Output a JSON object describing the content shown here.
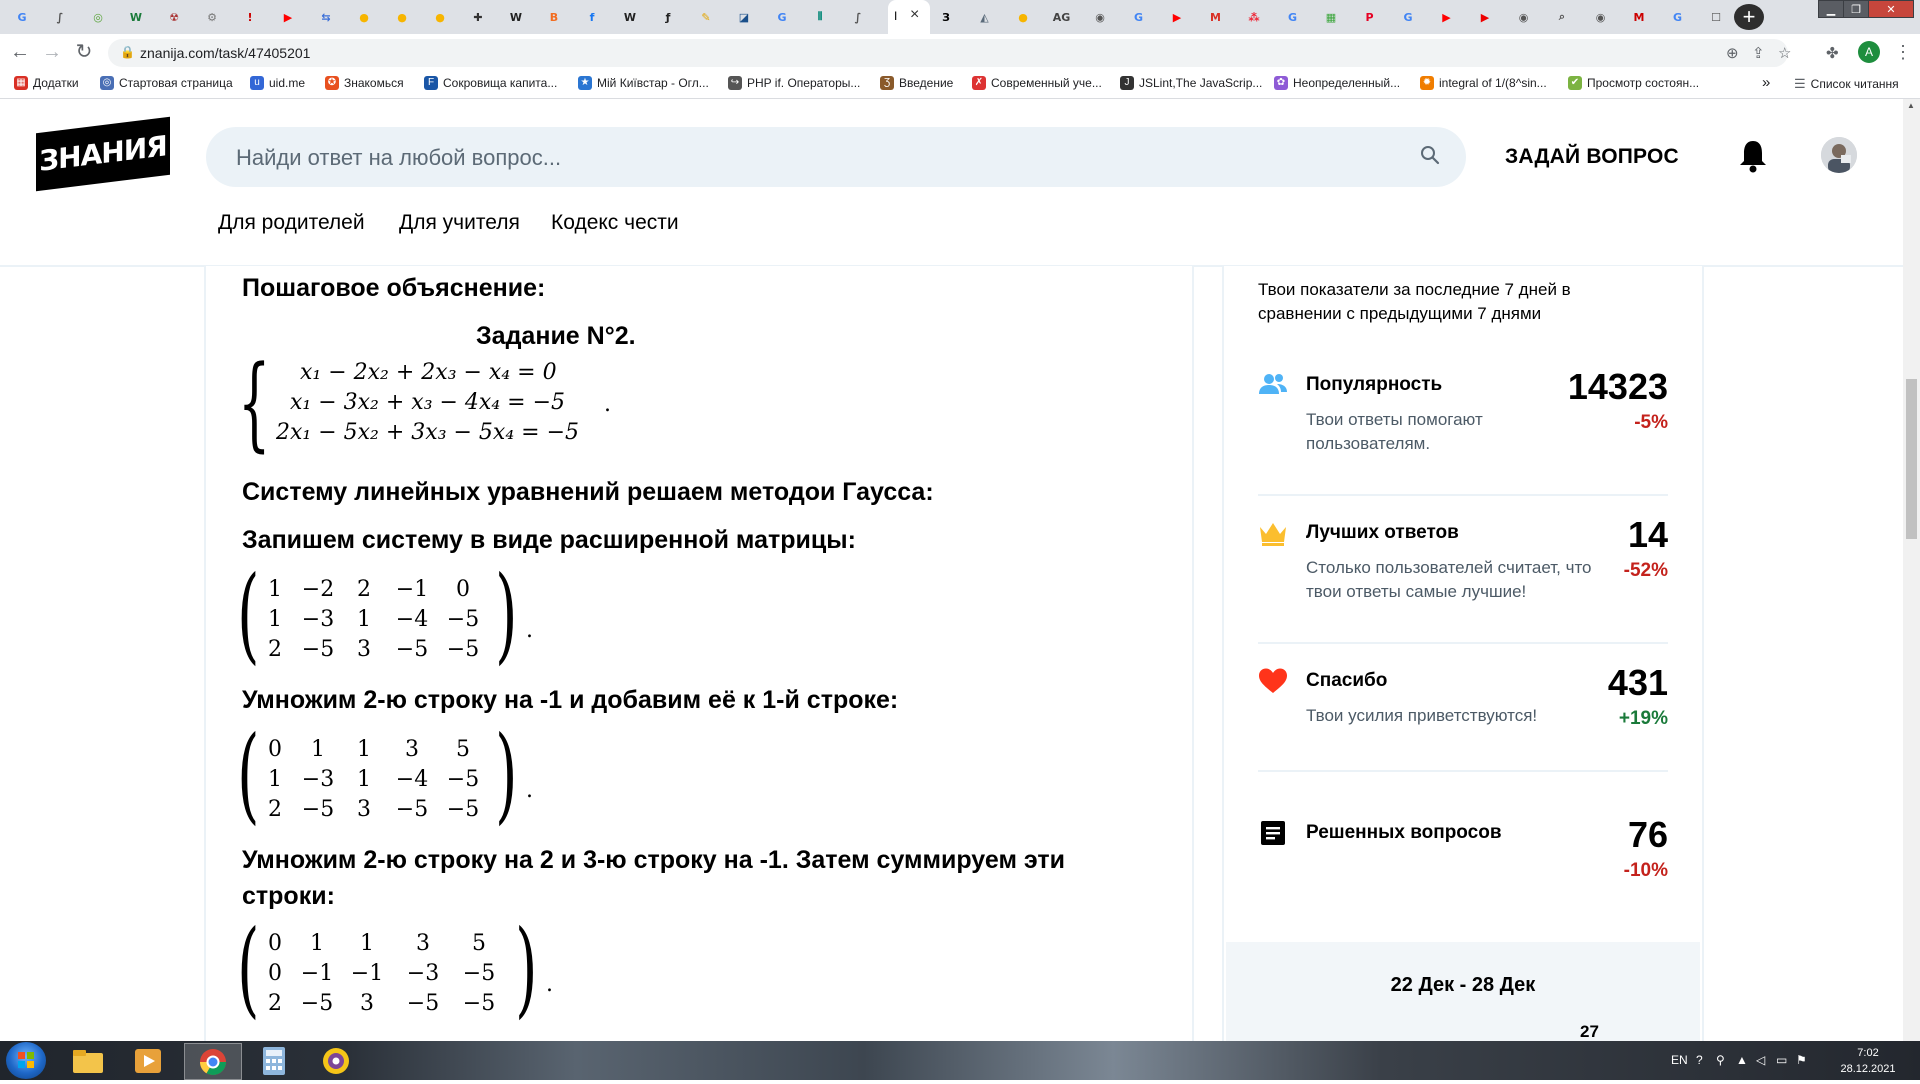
{
  "browser": {
    "tab_close": "×",
    "new_tab": "+",
    "url": "znanija.com/task/47405201",
    "profile_initial": "A",
    "tabs": [
      {
        "glyph": "G",
        "color": "#4285f4"
      },
      {
        "glyph": "∫",
        "color": "#555555"
      },
      {
        "glyph": "◎",
        "color": "#5aa43a"
      },
      {
        "glyph": "W",
        "color": "#1b7b3b"
      },
      {
        "glyph": "☢",
        "color": "#a33"
      },
      {
        "glyph": "⚙",
        "color": "#777"
      },
      {
        "glyph": "!",
        "color": "#c00"
      },
      {
        "glyph": "▶",
        "color": "#ff0000"
      },
      {
        "glyph": "⇆",
        "color": "#3b6fd8"
      },
      {
        "glyph": "●",
        "color": "#f7b500"
      },
      {
        "glyph": "●",
        "color": "#f7b500"
      },
      {
        "glyph": "●",
        "color": "#f7b500"
      },
      {
        "glyph": "✚",
        "color": "#333"
      },
      {
        "glyph": "W",
        "color": "#222"
      },
      {
        "glyph": "B",
        "color": "#f26d21"
      },
      {
        "glyph": "f",
        "color": "#1877f2"
      },
      {
        "glyph": "W",
        "color": "#222"
      },
      {
        "glyph": "ƒ",
        "color": "#222"
      },
      {
        "glyph": "✎",
        "color": "#e3a500"
      },
      {
        "glyph": "◪",
        "color": "#1a4f8a"
      },
      {
        "glyph": "G",
        "color": "#4285f4"
      },
      {
        "glyph": "⫴",
        "color": "#0b8a7b"
      },
      {
        "glyph": "∫",
        "color": "#555555"
      }
    ],
    "tabs_right": [
      {
        "glyph": "З",
        "color": "#000"
      },
      {
        "glyph": "◭",
        "color": "#5a6a7a"
      },
      {
        "glyph": "●",
        "color": "#f7b500"
      },
      {
        "glyph": "AG",
        "color": "#444"
      },
      {
        "glyph": "◉",
        "color": "#555"
      },
      {
        "glyph": "G",
        "color": "#4285f4"
      },
      {
        "glyph": "▶",
        "color": "#ff0000"
      },
      {
        "glyph": "M",
        "color": "#d93025"
      },
      {
        "glyph": "⁂",
        "color": "#e23"
      },
      {
        "glyph": "G",
        "color": "#4285f4"
      },
      {
        "glyph": "▦",
        "color": "#3aa53a"
      },
      {
        "glyph": "P",
        "color": "#e60023"
      },
      {
        "glyph": "G",
        "color": "#4285f4"
      },
      {
        "glyph": "▶",
        "color": "#ff0000"
      },
      {
        "glyph": "▶",
        "color": "#e00"
      },
      {
        "glyph": "◉",
        "color": "#555"
      },
      {
        "glyph": "⌕",
        "color": "#555"
      },
      {
        "glyph": "◉",
        "color": "#555"
      },
      {
        "glyph": "M",
        "color": "#c00"
      },
      {
        "glyph": "G",
        "color": "#4285f4"
      },
      {
        "glyph": "☐",
        "color": "#555"
      }
    ]
  },
  "bookmarks": {
    "items": [
      {
        "label": "Додатки",
        "color": "#d93025",
        "glyph": "▦"
      },
      {
        "label": "Стартовая страница",
        "color": "#4a6fb5",
        "glyph": "◎"
      },
      {
        "label": "uid.me",
        "color": "#3367d6",
        "glyph": "u"
      },
      {
        "label": "Знакомься",
        "color": "#e8501f",
        "glyph": "✪"
      },
      {
        "label": "Сокровища капита...",
        "color": "#1a56a6",
        "glyph": "F"
      },
      {
        "label": "Мій Київстар - Огл...",
        "color": "#2b76d2",
        "glyph": "★"
      },
      {
        "label": "PHP if. Операторы...",
        "color": "#555",
        "glyph": "↪"
      },
      {
        "label": "Введение",
        "color": "#8a5a2b",
        "glyph": "Ʒ"
      },
      {
        "label": "Современный уче...",
        "color": "#d33",
        "glyph": "✗"
      },
      {
        "label": "JSLint,The JavaScrip...",
        "color": "#333",
        "glyph": "J"
      },
      {
        "label": "Неопределенный...",
        "color": "#8e5bd6",
        "glyph": "✿"
      },
      {
        "label": "integral of 1/(8^sin...",
        "color": "#f07d00",
        "glyph": "✹"
      },
      {
        "label": "Просмотр состоян...",
        "color": "#7cb342",
        "glyph": "✔"
      }
    ],
    "more": "»",
    "reading_list": "Список читання"
  },
  "site": {
    "logo": "ЗНАНИЯ",
    "search_placeholder": "Найди ответ на любой вопрос...",
    "ask_button": "ЗАДАЙ ВОПРОС",
    "nav": [
      "Для родителей",
      "Для учителя",
      "Кодекс чести"
    ]
  },
  "answer": {
    "step_heading": "Пошаговое объяснение:",
    "task_heading": "Задание N°2.",
    "system": [
      "x₁ − 2x₂ + 2x₃ − x₄ = 0",
      "x₁ − 3x₂ + x₃ − 4x₄ = −5",
      "2x₁ − 5x₂ + 3x₃ − 5x₄ = −5"
    ],
    "system_period": ".",
    "line_gauss": "Систему линейных уравнений решаем методои Гаусса:",
    "line_matrix": "Запишем систему в виде расширенной матрицы:",
    "matrix1": [
      [
        "1",
        "−2",
        "2",
        "−1",
        "0"
      ],
      [
        "1",
        "−3",
        "1",
        "−4",
        "−5"
      ],
      [
        "2",
        "−5",
        "3",
        "−5",
        "−5"
      ]
    ],
    "line_step1": "Умножим 2-ю строку на -1 и добавим её к 1-й строке:",
    "matrix2": [
      [
        "0",
        "1",
        "1",
        "3",
        "5"
      ],
      [
        "1",
        "−3",
        "1",
        "−4",
        "−5"
      ],
      [
        "2",
        "−5",
        "3",
        "−5",
        "−5"
      ]
    ],
    "line_step2a": "Умножим 2-ю строку на 2 и 3-ю строку на -1. Затем суммируем эти",
    "line_step2b": "строки:",
    "matrix3": [
      [
        "0",
        "1",
        "1",
        "3",
        "5"
      ],
      [
        "0",
        "−1",
        "−1",
        "−3",
        "−5"
      ],
      [
        "2",
        "−5",
        "3",
        "−5",
        "−5"
      ]
    ],
    "matrix_period": "."
  },
  "sidebar": {
    "intro": "Твои показатели за последние 7 дней в сравнении с предыдущими 7 днями",
    "stats": [
      {
        "title": "Популярность",
        "desc": "Твои ответы помогают пользователям.",
        "value": "14323",
        "delta": "-5%",
        "delta_color": "#c4221c"
      },
      {
        "title": "Лучших ответов",
        "desc": "Столько пользователей считает, что твои ответы самые лучшие!",
        "value": "14",
        "delta": "-52%",
        "delta_color": "#c4221c"
      },
      {
        "title": "Спасибо",
        "desc": "Твои усилия приветствуются!",
        "value": "431",
        "delta": "+19%",
        "delta_color": "#1a7a3a"
      },
      {
        "title": "Решенных вопросов",
        "desc": "",
        "value": "76",
        "delta": "-10%",
        "delta_color": "#c4221c"
      }
    ],
    "chart_range": "22 Дек - 28 Дек",
    "chart_tick": "27"
  },
  "taskbar": {
    "lang": "EN",
    "time": "7:02",
    "date": "28.12.2021"
  },
  "colors": {
    "accent_blue": "#4fb3f6",
    "crown": "#fbbe2e",
    "heart": "#ff341a",
    "search_bg": "#ebf2f7"
  }
}
